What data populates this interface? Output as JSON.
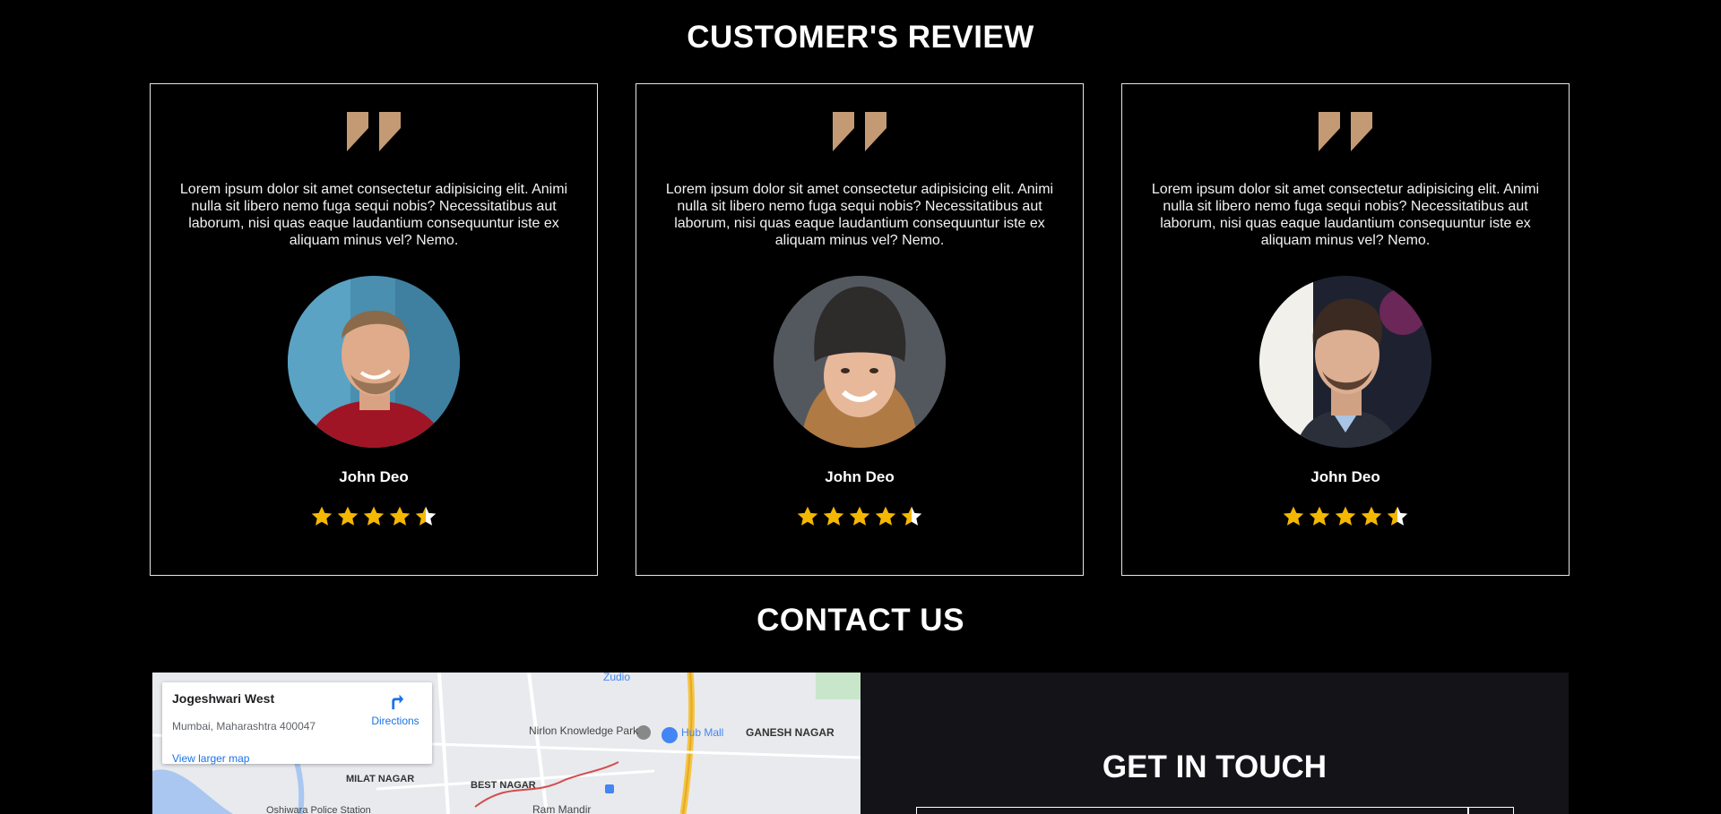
{
  "reviews": {
    "title": "CUSTOMER'S REVIEW",
    "cards": [
      {
        "text": "Lorem ipsum dolor sit amet consectetur adipisicing elit. Animi nulla sit libero nemo fuga sequi nobis? Necessitatibus aut laborum, nisi quas eaque laudantium consequuntur iste ex aliquam minus vel? Nemo.",
        "name": "John Deo",
        "rating": 4.5
      },
      {
        "text": "Lorem ipsum dolor sit amet consectetur adipisicing elit. Animi nulla sit libero nemo fuga sequi nobis? Necessitatibus aut laborum, nisi quas eaque laudantium consequuntur iste ex aliquam minus vel? Nemo.",
        "name": "John Deo",
        "rating": 4.5
      },
      {
        "text": "Lorem ipsum dolor sit amet consectetur adipisicing elit. Animi nulla sit libero nemo fuga sequi nobis? Necessitatibus aut laborum, nisi quas eaque laudantium consequuntur iste ex aliquam minus vel? Nemo.",
        "name": "John Deo",
        "rating": 4.5
      }
    ],
    "quote_color": "#c49a74",
    "star_color": "#f5b800"
  },
  "contact": {
    "title": "CONTACT US",
    "map": {
      "place": "Jogeshwari West",
      "address": "Mumbai, Maharashtra 400047",
      "directions": "Directions",
      "larger_map": "View larger map",
      "labels": {
        "nirlon": "Nirlon Knowledge Park",
        "hub_mall": "Hub Mall",
        "ganesh_nagar": "GANESH NAGAR",
        "milat_nagar": "MILAT NAGAR",
        "best_nagar": "BEST NAGAR",
        "ram_mandir": "Ram Mandir",
        "zudio": "Zudio",
        "oshiwara": "Oshiwara Police Station"
      }
    },
    "touch_title": "GET IN TOUCH"
  }
}
